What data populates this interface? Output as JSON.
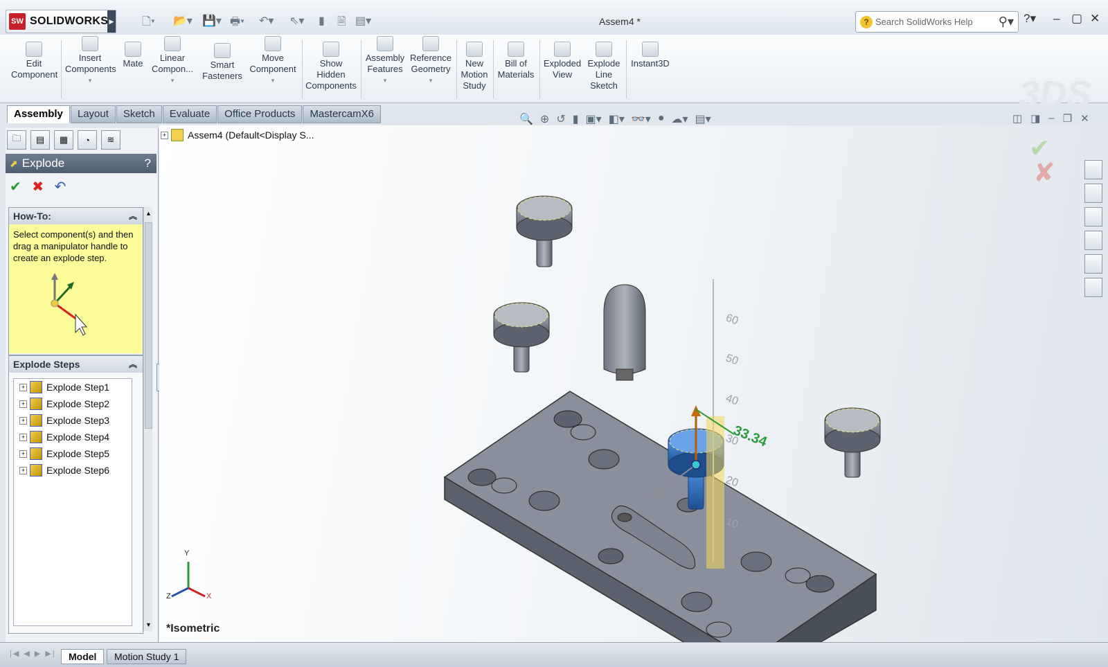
{
  "app": {
    "logo_text": "SOLIDWORKS",
    "doc_title": "Assem4 *"
  },
  "search": {
    "placeholder": "Search SolidWorks Help"
  },
  "ribbon": {
    "buttons": [
      {
        "id": "edit-component",
        "lines": [
          "Edit",
          "Component"
        ]
      },
      {
        "id": "insert-components",
        "lines": [
          "Insert",
          "Components"
        ]
      },
      {
        "id": "mate",
        "lines": [
          "Mate"
        ]
      },
      {
        "id": "linear-component",
        "lines": [
          "Linear",
          "Compon..."
        ]
      },
      {
        "id": "smart-fasteners",
        "lines": [
          "Smart",
          "Fasteners"
        ]
      },
      {
        "id": "move-component",
        "lines": [
          "Move",
          "Component"
        ]
      },
      {
        "id": "show-hidden",
        "lines": [
          "Show",
          "Hidden",
          "Components"
        ]
      },
      {
        "id": "assembly-features",
        "lines": [
          "Assembly",
          "Features"
        ]
      },
      {
        "id": "reference-geometry",
        "lines": [
          "Reference",
          "Geometry"
        ]
      },
      {
        "id": "new-motion-study",
        "lines": [
          "New",
          "Motion",
          "Study"
        ]
      },
      {
        "id": "bill-of-materials",
        "lines": [
          "Bill of",
          "Materials"
        ]
      },
      {
        "id": "exploded-view",
        "lines": [
          "Exploded",
          "View"
        ]
      },
      {
        "id": "explode-line-sketch",
        "lines": [
          "Explode",
          "Line",
          "Sketch"
        ]
      },
      {
        "id": "instant3d",
        "lines": [
          "Instant3D"
        ]
      }
    ]
  },
  "tabs": [
    "Assembly",
    "Layout",
    "Sketch",
    "Evaluate",
    "Office Products",
    "MastercamX6"
  ],
  "property_manager": {
    "title": "Explode",
    "help": "?",
    "howto_title": "How-To:",
    "howto_text": "Select component(s) and then drag a manipulator handle to create an explode step.",
    "steps_title": "Explode Steps",
    "steps": [
      "Explode Step1",
      "Explode Step2",
      "Explode Step3",
      "Explode Step4",
      "Explode Step5",
      "Explode Step6"
    ]
  },
  "viewport": {
    "tree_root": "Assem4  (Default<Display S...",
    "view_label": "*Isometric",
    "ruler": {
      "ticks": [
        "60",
        "50",
        "40",
        "30",
        "20",
        "10"
      ],
      "value": "33.34"
    }
  },
  "triad": {
    "y": "Y",
    "x": "X",
    "z": "Z"
  },
  "bottom_tabs": [
    "Model",
    "Motion Study 1"
  ],
  "colors": {
    "accent": "#c8202a",
    "selected_part": "#2f6fbf",
    "howto_bg": "#fbfb9a",
    "ruler_value": "#2e9a3a"
  }
}
